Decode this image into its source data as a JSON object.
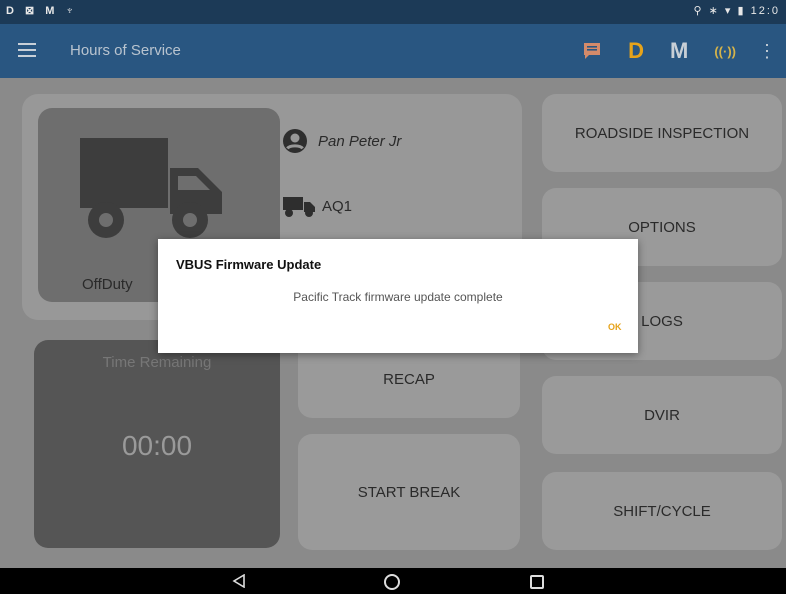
{
  "status_bar": {
    "left": "D ⊠ M ♆",
    "right": "⚲ ∗ ▾ ▮ 12:0"
  },
  "app_bar": {
    "title": "Hours of Service",
    "actions": {
      "d_label": "D",
      "m_label": "M",
      "antenna_label": "((·))",
      "overflow": "⋮"
    }
  },
  "duty": {
    "status": "OffDuty",
    "driver_name": "Pan Peter Jr",
    "vehicle_id": "AQ1"
  },
  "time_remaining": {
    "label": "Time Remaining",
    "value": "00:00"
  },
  "buttons": {
    "recap": "RECAP",
    "start_break": "START BREAK",
    "roadside_inspection": "ROADSIDE INSPECTION",
    "options": "OPTIONS",
    "logs": "LOGS",
    "dvir": "DVIR",
    "shift_cycle": "SHIFT/CYCLE"
  },
  "dialog": {
    "title": "VBUS Firmware Update",
    "message": "Pacific Track firmware update complete",
    "ok": "OK"
  },
  "colors": {
    "app_bar": "#295681",
    "status_bar": "#1c3a57",
    "accent": "#e6a31a",
    "overlay": "#8a8a8a"
  },
  "icons": [
    "menu-icon",
    "message-icon",
    "antenna-icon",
    "overflow-menu-icon",
    "truck-icon",
    "person-icon",
    "vehicle-icon",
    "back-icon",
    "home-icon",
    "recents-icon"
  ]
}
